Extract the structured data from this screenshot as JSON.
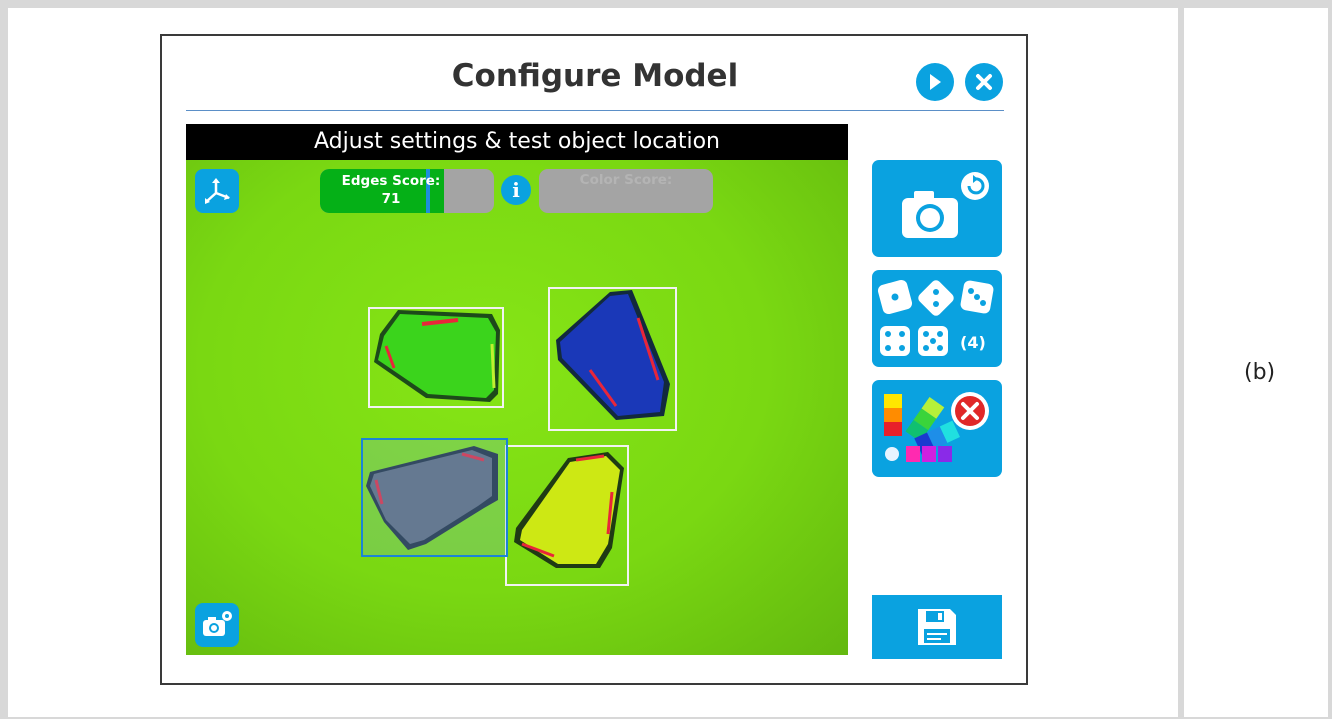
{
  "dialog": {
    "title": "Configure Model"
  },
  "view": {
    "header": "Adjust settings & test object location",
    "edges_score": {
      "label": "Edges Score:",
      "value": "71",
      "level": 0.71
    },
    "color_score": {
      "label": "Color Score:"
    }
  },
  "side_panel": {
    "models_count": "(4)"
  },
  "caption": "(b)",
  "colors": {
    "accent": "#0aa2e0",
    "score_fill": "#05b017",
    "background_green": "#7ad812"
  },
  "icons": [
    "play-icon",
    "close-icon",
    "axes-icon",
    "info-icon",
    "camera-refresh-icon",
    "dice-icon",
    "color-palette-icon",
    "save-icon",
    "camera-settings-icon"
  ]
}
